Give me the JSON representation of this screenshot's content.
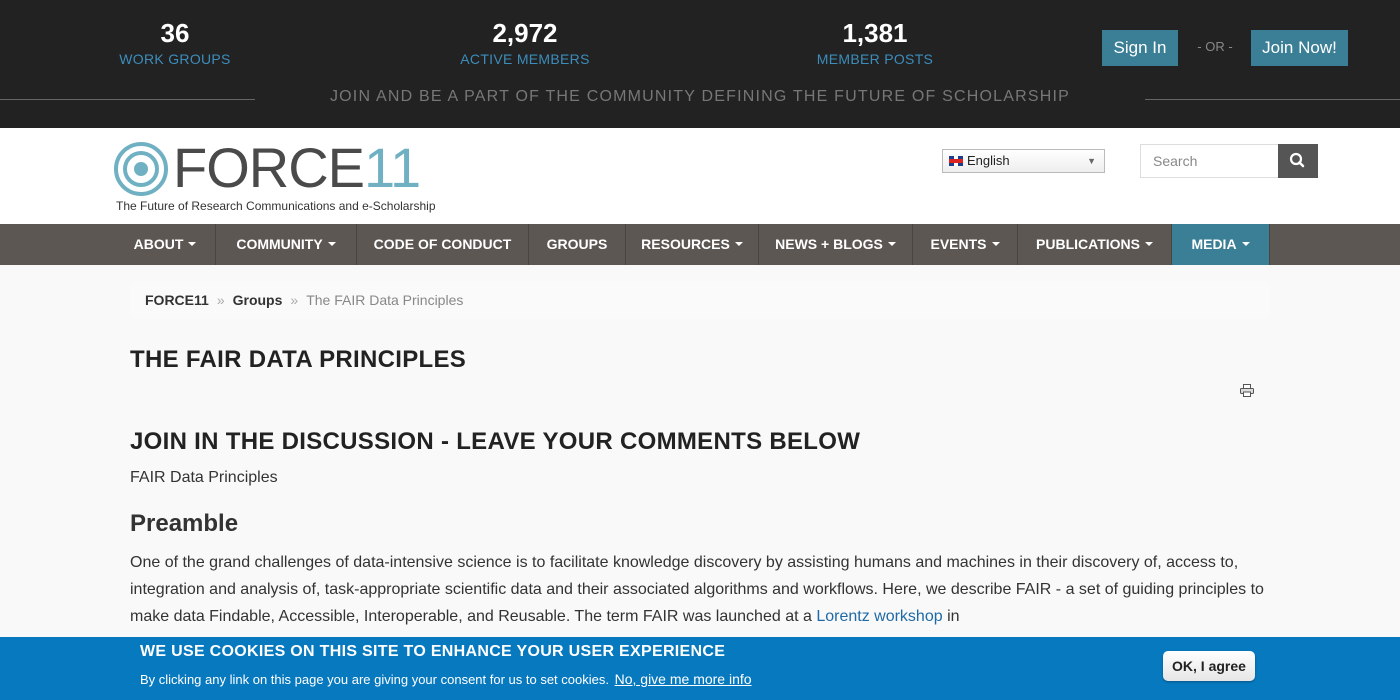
{
  "stats": [
    {
      "value": "36",
      "label": "WORK GROUPS"
    },
    {
      "value": "2,972",
      "label": "ACTIVE MEMBERS"
    },
    {
      "value": "1,381",
      "label": "MEMBER POSTS"
    }
  ],
  "auth": {
    "signin_label": "Sign In",
    "or_label": "- OR -",
    "join_label": "Join Now!"
  },
  "tagline": "JOIN AND BE A PART OF THE COMMUNITY DEFINING THE FUTURE OF SCHOLARSHIP",
  "logo": {
    "word_main": "FORCE",
    "word_num": "11",
    "subtitle": "The Future of Research Communications and e-Scholarship"
  },
  "language": {
    "selected": "English"
  },
  "search": {
    "placeholder": "Search"
  },
  "nav": {
    "items": [
      {
        "label": "ABOUT",
        "dropdown": true
      },
      {
        "label": "COMMUNITY",
        "dropdown": true
      },
      {
        "label": "CODE OF CONDUCT",
        "dropdown": false
      },
      {
        "label": "GROUPS",
        "dropdown": false
      },
      {
        "label": "RESOURCES",
        "dropdown": true
      },
      {
        "label": "NEWS + BLOGS",
        "dropdown": true
      },
      {
        "label": "EVENTS",
        "dropdown": true
      },
      {
        "label": "PUBLICATIONS",
        "dropdown": true
      },
      {
        "label": "MEDIA",
        "dropdown": true,
        "active": true
      }
    ]
  },
  "breadcrumb": {
    "items": [
      "FORCE11",
      "Groups"
    ],
    "separator": "»",
    "current": "The FAIR Data Principles"
  },
  "page": {
    "title": "THE FAIR DATA PRINCIPLES",
    "join_heading": "JOIN IN THE DISCUSSION - LEAVE YOUR COMMENTS BELOW",
    "fair_label": "FAIR Data Principles",
    "preamble_heading": "Preamble",
    "preamble_text": "One of the grand challenges of data-intensive science is to facilitate knowledge discovery by assisting humans and machines in their discovery of, access to, integration and analysis of, task-appropriate scientific data and their associated algorithms and workflows. Here, we describe FAIR - a set of guiding principles to make data Findable, Accessible, Interoperable, and Reusable.  The term FAIR was launched at a ",
    "link_text": "Lorentz workshop",
    "after_link": " in"
  },
  "cookie": {
    "title": "WE USE COOKIES ON THIS SITE TO ENHANCE YOUR USER EXPERIENCE",
    "text": "By clicking any link on this page you are giving your consent for us to set cookies.",
    "more_link": "No, give me more info",
    "ok_label": "OK, I agree"
  },
  "colors": {
    "topbar": "#222222",
    "accent": "#3a7f96",
    "nav": "#5d5753",
    "cookie": "#0779bf",
    "stat_label": "#3c8dbc"
  },
  "icons": {
    "search": "search-icon",
    "print": "print-icon",
    "flag": "uk-flag-icon",
    "target": "force11-target-icon"
  }
}
